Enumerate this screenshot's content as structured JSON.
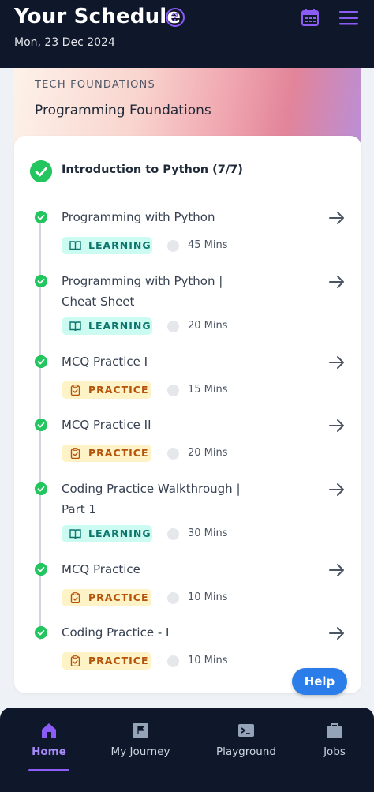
{
  "header": {
    "title": "Your Schedule",
    "help_glyph": "?",
    "date": "Mon, 23 Dec 2024",
    "accent": "#8b5cf6",
    "icons": [
      "question-circle-icon",
      "calendar-icon",
      "hamburger-menu-icon"
    ]
  },
  "banner": {
    "kicker": "TECH FOUNDATIONS",
    "course": "Programming Foundations"
  },
  "section": {
    "title": "Introduction to Python (7/7)",
    "status": "completed"
  },
  "items": [
    {
      "name": "Programming with Python",
      "tag": "LEARNING",
      "duration": "45 Mins",
      "done": true
    },
    {
      "name": "Programming with Python | Cheat Sheet",
      "tag": "LEARNING",
      "duration": "20 Mins",
      "done": true
    },
    {
      "name": "MCQ Practice I",
      "tag": "PRACTICE",
      "duration": "15 Mins",
      "done": true
    },
    {
      "name": "MCQ Practice II",
      "tag": "PRACTICE",
      "duration": "20 Mins",
      "done": true
    },
    {
      "name": "Coding Practice Walkthrough | Part 1",
      "tag": "LEARNING",
      "duration": "30 Mins",
      "done": true
    },
    {
      "name": "MCQ Practice",
      "tag": "PRACTICE",
      "duration": "10 Mins",
      "done": true
    },
    {
      "name": "Coding Practice - I",
      "tag": "PRACTICE",
      "duration": "10 Mins",
      "done": true
    }
  ],
  "help_button": "Help",
  "nav": {
    "tabs": [
      {
        "label": "Home",
        "icon": "home-icon",
        "active": true
      },
      {
        "label": "My Journey",
        "icon": "flag-icon",
        "active": false
      },
      {
        "label": "Playground",
        "icon": "terminal-icon",
        "active": false
      },
      {
        "label": "Jobs",
        "icon": "briefcase-icon",
        "active": false
      }
    ]
  },
  "colors": {
    "success": "#22c55e",
    "learning_bg": "#ccfbf1",
    "learning_text": "#0f766e",
    "practice_bg": "#fef3c7",
    "practice_text": "#b45309",
    "help_button": "#2b7de9",
    "dark_bar": "#0f172a"
  }
}
